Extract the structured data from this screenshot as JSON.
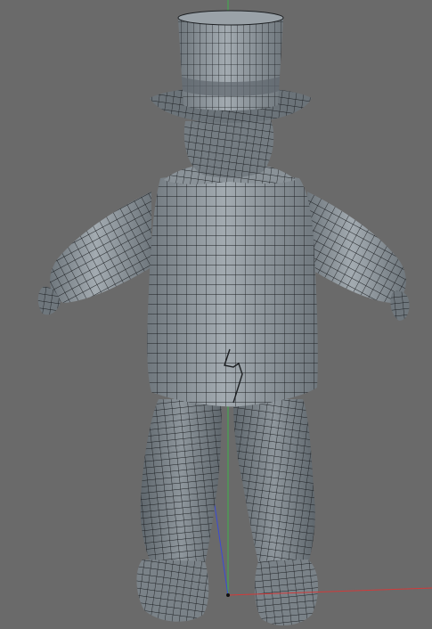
{
  "viewport": {
    "background_color": "#6a6a6a",
    "model_fill_color": "#8d959b",
    "wireframe_color": "#1c1f22",
    "axis_colors": {
      "x": "#d23a3a",
      "y": "#3fb34a",
      "z": "#3b4bd6"
    }
  },
  "model": {
    "parts": [
      "top-hat",
      "head",
      "collar",
      "jacket",
      "left-arm",
      "right-arm",
      "left-hand",
      "right-hand",
      "left-leg",
      "right-leg",
      "left-boot",
      "right-boot"
    ]
  }
}
